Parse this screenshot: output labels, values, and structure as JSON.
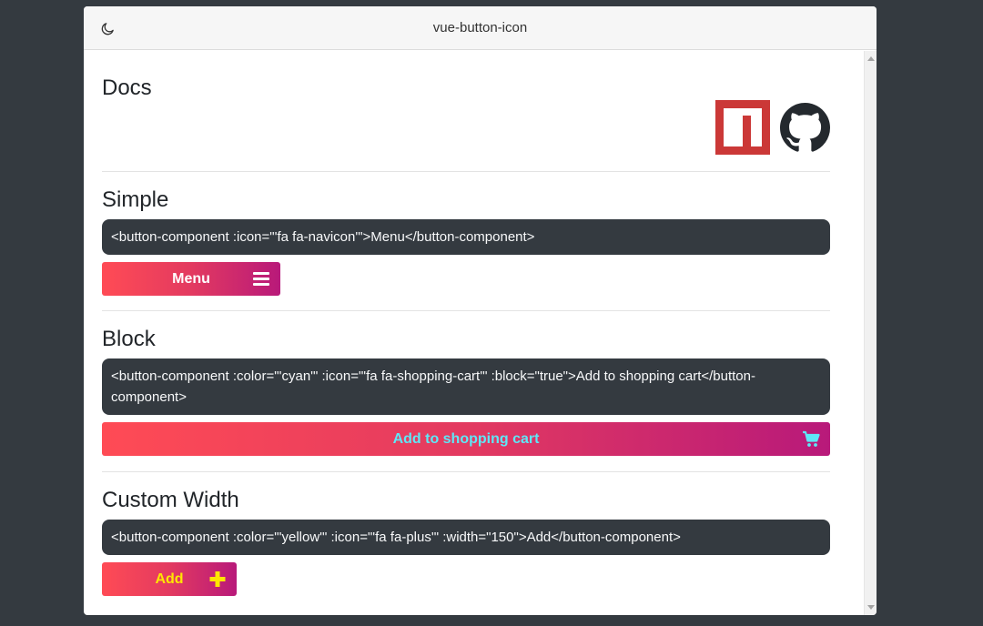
{
  "window": {
    "title": "vue-button-icon"
  },
  "docs": {
    "heading": "Docs"
  },
  "simple": {
    "heading": "Simple",
    "code": "<button-component :icon=\"'fa fa-navicon'\">Menu</button-component>",
    "button_label": "Menu"
  },
  "block": {
    "heading": "Block",
    "code": "<button-component :color=\"'cyan'\" :icon=\"'fa fa-shopping-cart'\" :block=\"true\">Add to shopping cart</button-component>",
    "button_label": "Add to shopping cart"
  },
  "custom": {
    "heading": "Custom Width",
    "code": "<button-component :color=\"'yellow'\" :icon=\"'fa fa-plus'\" :width=\"150\">Add</button-component>",
    "button_label": "Add"
  },
  "icons": [
    "moon-icon",
    "npm-logo",
    "github-logo",
    "menu-icon",
    "shopping-cart-icon",
    "plus-icon"
  ],
  "colors": {
    "cyan": "#5ee7f7",
    "yellow": "#ffe600",
    "gradient_start": "#ff4b55",
    "gradient_end": "#b8197a",
    "code_bg": "#343a40"
  }
}
